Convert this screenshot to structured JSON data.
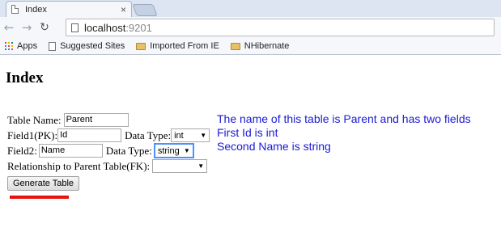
{
  "browser": {
    "tab_title": "Index",
    "tab_close": "×",
    "url_host": "localhost",
    "url_port": ":9201",
    "back": "←",
    "forward": "→",
    "reload": "↻",
    "bookmarks": [
      {
        "label": "Apps",
        "icon": "apps-grid-icon"
      },
      {
        "label": "Suggested Sites",
        "icon": "page-icon"
      },
      {
        "label": "Imported From IE",
        "icon": "folder-icon"
      },
      {
        "label": "NHibernate",
        "icon": "folder-icon"
      }
    ],
    "apps_icon_colors": [
      "#e04a3f",
      "#f4b400",
      "#0f9d58",
      "#4285f4",
      "#e04a3f",
      "#f4b400",
      "#0f9d58",
      "#4285f4",
      "#e04a3f"
    ]
  },
  "page": {
    "heading": "Index",
    "form": {
      "table_name_label": "Table Name:",
      "table_name_value": "Parent",
      "field1_label": "Field1(PK):",
      "field1_value": "Id",
      "field1_type_label": "Data Type:",
      "field1_type_value": "int",
      "field2_label": "Field2:",
      "field2_value": "Name",
      "field2_type_label": "Data Type:",
      "field2_type_value": "string",
      "relationship_label": "Relationship to Parent Table(FK):",
      "relationship_value": "",
      "generate_button": "Generate Table"
    },
    "note_lines": [
      "The name of this table is Parent and has two fields",
      "First Id is int",
      "Second Name is string"
    ],
    "note_color": "#1a1ad6",
    "highlight_color": "#e8130c"
  }
}
